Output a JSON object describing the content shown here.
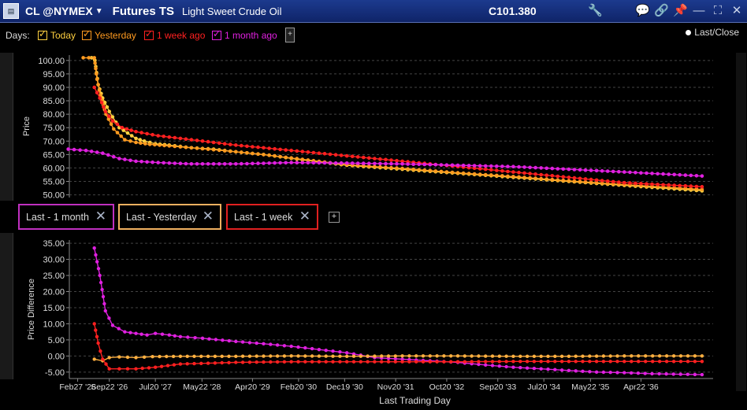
{
  "window": {
    "symbol": "CL @NYMEX",
    "title": "Futures TS",
    "description": "Light Sweet Crude Oil",
    "last_price": "C101.380"
  },
  "days": {
    "label": "Days:",
    "items": [
      {
        "label": "Today",
        "color": "#ffd040"
      },
      {
        "label": "Yesterday",
        "color": "#ff9b20"
      },
      {
        "label": "1 week ago",
        "color": "#ff2020"
      },
      {
        "label": "1 month ago",
        "color": "#e020e0"
      }
    ],
    "add_label": "+",
    "last_close_label": "Last/Close"
  },
  "diff_buttons": [
    {
      "label": "Last - 1 month",
      "color": "#c030c0"
    },
    {
      "label": "Last - Yesterday",
      "color": "#f0b060"
    },
    {
      "label": "Last - 1 week",
      "color": "#e02020"
    }
  ],
  "chart_data": [
    {
      "type": "line",
      "ylabel": "Price",
      "ylim": [
        49,
        102
      ],
      "yticks": [
        "100.00",
        "95.00",
        "90.00",
        "85.00",
        "80.00",
        "75.00",
        "70.00",
        "65.00",
        "60.00",
        "55.00",
        "50.00"
      ],
      "x_range": [
        2026.0,
        2037.6
      ],
      "grid": true,
      "series": [
        {
          "name": "Today",
          "color": "#ffd040",
          "x": [
            2026.4,
            2026.46,
            2026.52,
            2026.6,
            2026.72,
            2026.9,
            2027.2,
            2027.35,
            2027.55,
            2027.8,
            2028.2,
            2028.6,
            2029.0,
            2029.5,
            2030.2,
            2031.0,
            2032.0,
            2033.0,
            2034.0,
            2035.0,
            2036.0,
            2037.4
          ],
          "y": [
            101.0,
            100.0,
            91.0,
            86.0,
            81.0,
            75.0,
            71.0,
            70.0,
            69.0,
            68.5,
            67.5,
            67.0,
            66.0,
            65.0,
            63.0,
            61.0,
            59.5,
            58.0,
            56.5,
            55.0,
            53.5,
            51.5
          ]
        },
        {
          "name": "Yesterday",
          "color": "#ff9b20",
          "x": [
            2026.25,
            2026.45,
            2026.5,
            2026.56,
            2026.66,
            2026.8,
            2027.0,
            2027.2,
            2027.45,
            2027.8,
            2028.2,
            2028.6,
            2029.0,
            2029.5,
            2030.2,
            2031.0,
            2032.0,
            2033.0,
            2034.0,
            2035.0,
            2036.0,
            2037.4
          ],
          "y": [
            101.0,
            101.0,
            93.0,
            87.0,
            80.0,
            74.5,
            70.5,
            69.5,
            68.8,
            68.2,
            67.5,
            66.8,
            66.0,
            65.0,
            63.2,
            61.2,
            59.8,
            58.2,
            56.8,
            55.2,
            53.8,
            52.0
          ]
        },
        {
          "name": "1 week ago",
          "color": "#ff2020",
          "x": [
            2026.45,
            2026.55,
            2026.65,
            2026.78,
            2026.95,
            2027.2,
            2027.6,
            2028.2,
            2029.0,
            2030.0,
            2031.0,
            2032.0,
            2033.0,
            2034.0,
            2035.0,
            2036.0,
            2037.4
          ],
          "y": [
            90.0,
            86.0,
            81.0,
            77.5,
            75.0,
            73.5,
            72.0,
            70.5,
            68.5,
            66.5,
            64.5,
            62.5,
            60.5,
            58.5,
            56.5,
            54.5,
            53.0
          ]
        },
        {
          "name": "1 month ago",
          "color": "#e020e0",
          "x": [
            2025.98,
            2026.3,
            2026.6,
            2026.9,
            2027.2,
            2027.6,
            2028.2,
            2029.0,
            2030.0,
            2031.0,
            2032.0,
            2033.0,
            2034.0,
            2035.0,
            2036.0,
            2037.4
          ],
          "y": [
            67.0,
            66.5,
            65.5,
            63.5,
            62.5,
            62.0,
            61.5,
            61.5,
            62.0,
            61.8,
            61.5,
            61.0,
            60.5,
            59.5,
            58.5,
            57.0
          ]
        }
      ]
    },
    {
      "type": "line",
      "ylabel": "Price Difference",
      "ylim": [
        -7,
        36
      ],
      "yticks": [
        "35.00",
        "30.00",
        "25.00",
        "20.00",
        "15.00",
        "10.00",
        "5.00",
        "0.00",
        "-5.00"
      ],
      "x_range": [
        2026.0,
        2037.6
      ],
      "xlabel": "Last Trading Day",
      "xticks": [
        "Feb27 '26",
        "Sep22 '26",
        "Jul20 '27",
        "May22 '28",
        "Apr20 '29",
        "Feb20 '30",
        "Dec19 '30",
        "Nov20 '31",
        "Oct20 '32",
        "Sep20 '33",
        "Jul20 '34",
        "May22 '35",
        "Apr22 '36"
      ],
      "xtick_pos": [
        2026.15,
        2026.72,
        2027.55,
        2028.39,
        2029.3,
        2030.13,
        2030.96,
        2031.88,
        2032.8,
        2033.72,
        2034.55,
        2035.39,
        2036.3
      ],
      "grid": true,
      "series": [
        {
          "name": "Last - 1 month",
          "color": "#e020e0",
          "x": [
            2026.45,
            2026.55,
            2026.65,
            2026.78,
            2027.0,
            2027.2,
            2027.4,
            2027.55,
            2027.8,
            2028.0,
            2028.4,
            2029.0,
            2029.5,
            2030.0,
            2030.5,
            2031.0,
            2031.5,
            2032.0,
            2032.5,
            2033.0,
            2033.5,
            2034.0,
            2034.5,
            2035.0,
            2035.5,
            2036.0,
            2036.5,
            2037.4
          ],
          "y": [
            33.5,
            25.0,
            14.0,
            9.5,
            7.5,
            7.0,
            6.5,
            7.0,
            6.5,
            6.0,
            5.5,
            4.5,
            3.8,
            3.0,
            2.0,
            1.0,
            -0.5,
            -1.0,
            -1.5,
            -2.0,
            -2.8,
            -3.5,
            -4.0,
            -4.5,
            -5.0,
            -5.2,
            -5.5,
            -5.8
          ]
        },
        {
          "name": "Last - Yesterday",
          "color": "#ffb040",
          "x": [
            2026.45,
            2026.6,
            2026.72,
            2026.9,
            2027.2,
            2027.5,
            2028.0,
            2029.0,
            2030.0,
            2031.0,
            2032.0,
            2033.0,
            2034.0,
            2035.0,
            2036.0,
            2037.4
          ],
          "y": [
            -1.0,
            -1.5,
            -0.5,
            -0.3,
            -0.5,
            -0.2,
            -0.1,
            -0.1,
            0.0,
            -0.1,
            0.0,
            0.0,
            -0.1,
            -0.1,
            0.0,
            0.0
          ]
        },
        {
          "name": "Last - 1 week",
          "color": "#ff2020",
          "x": [
            2026.45,
            2026.52,
            2026.6,
            2026.72,
            2026.9,
            2027.2,
            2027.55,
            2028.0,
            2029.0,
            2030.0,
            2031.0,
            2032.0,
            2033.0,
            2034.0,
            2035.0,
            2036.0,
            2037.4
          ],
          "y": [
            10.0,
            4.0,
            -1.0,
            -4.0,
            -4.0,
            -4.0,
            -3.5,
            -2.5,
            -2.0,
            -1.8,
            -1.8,
            -1.8,
            -1.8,
            -1.7,
            -1.7,
            -1.7,
            -1.7
          ]
        }
      ]
    }
  ]
}
